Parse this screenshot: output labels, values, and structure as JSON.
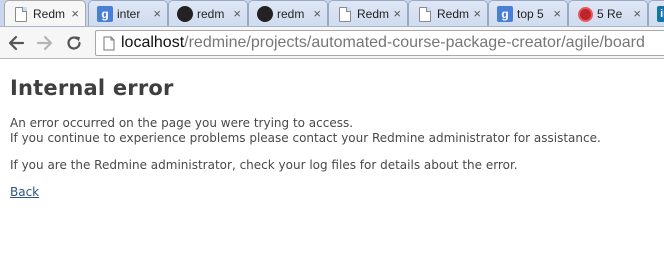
{
  "browser": {
    "tabs": [
      {
        "title": "Redm",
        "icon": "document-icon",
        "active": true
      },
      {
        "title": "inter",
        "icon": "google-icon",
        "active": false
      },
      {
        "title": "redm",
        "icon": "github-icon",
        "active": false
      },
      {
        "title": "redm",
        "icon": "github-icon",
        "active": false
      },
      {
        "title": "Redm",
        "icon": "document-icon",
        "active": false
      },
      {
        "title": "Redm",
        "icon": "document-icon",
        "active": false
      },
      {
        "title": "top 5",
        "icon": "google-icon",
        "active": false
      },
      {
        "title": "5 Re",
        "icon": "red-circle-icon",
        "active": false
      },
      {
        "title": "",
        "icon": "linkedin-icon",
        "active": false
      }
    ],
    "close_glyph": "×",
    "address_bar": {
      "host": "localhost",
      "path": "/redmine/projects/automated-course-package-creator/agile/board"
    }
  },
  "page": {
    "title": "Internal error",
    "line1": "An error occurred on the page you were trying to access.",
    "line2": "If you continue to experience problems please contact your Redmine administrator for assistance.",
    "line3": "If you are the Redmine administrator, check your log files for details about the error.",
    "back_link": "Back"
  }
}
